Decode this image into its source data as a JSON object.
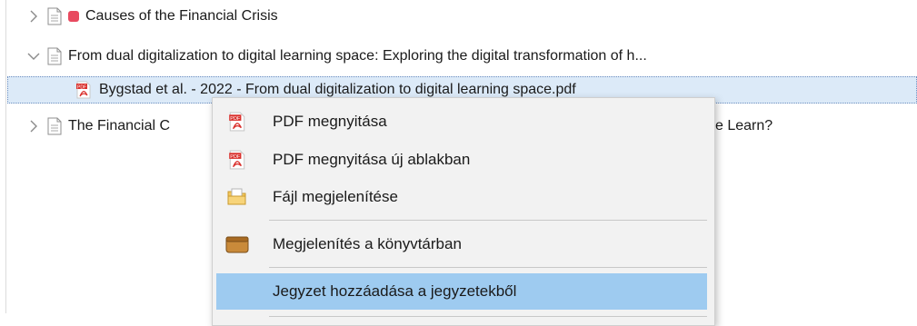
{
  "tree": {
    "rows": [
      {
        "label": "Causes of the Financial Crisis",
        "expander": "chevron-right-icon",
        "item_icon": "document-icon",
        "tag_color": "#e84a5f"
      },
      {
        "label": "From dual digitalization to digital learning space: Exploring the digital transformation of h...",
        "expander": "chevron-down-icon",
        "item_icon": "document-icon"
      },
      {
        "label": "Bygstad et al. - 2022 - From dual digitalization to digital learning space.pdf",
        "item_icon": "pdf-icon",
        "selected": true
      },
      {
        "label_left": "The Financial C",
        "label_right": "e Learn?",
        "expander": "chevron-right-icon",
        "item_icon": "document-icon"
      }
    ]
  },
  "context_menu": {
    "items": [
      {
        "label": "PDF megnyitása",
        "icon": "pdf-icon"
      },
      {
        "label": "PDF megnyitása új ablakban",
        "icon": "pdf-icon"
      },
      {
        "label": "Fájl megjelenítése",
        "icon": "folder-icon"
      },
      {
        "label": "Megjelenítés a könyvtárban",
        "icon": "library-box-icon"
      },
      {
        "label": "Jegyzet hozzáadása a jegyzetekből",
        "icon": "",
        "highlighted": true
      }
    ]
  },
  "colors": {
    "selection_bg": "#dceaf8",
    "menu_hover_bg": "#9ecbf0",
    "menu_bg": "#f2f2f2",
    "tag_red": "#e84a5f",
    "pdf_red": "#d9302c"
  }
}
